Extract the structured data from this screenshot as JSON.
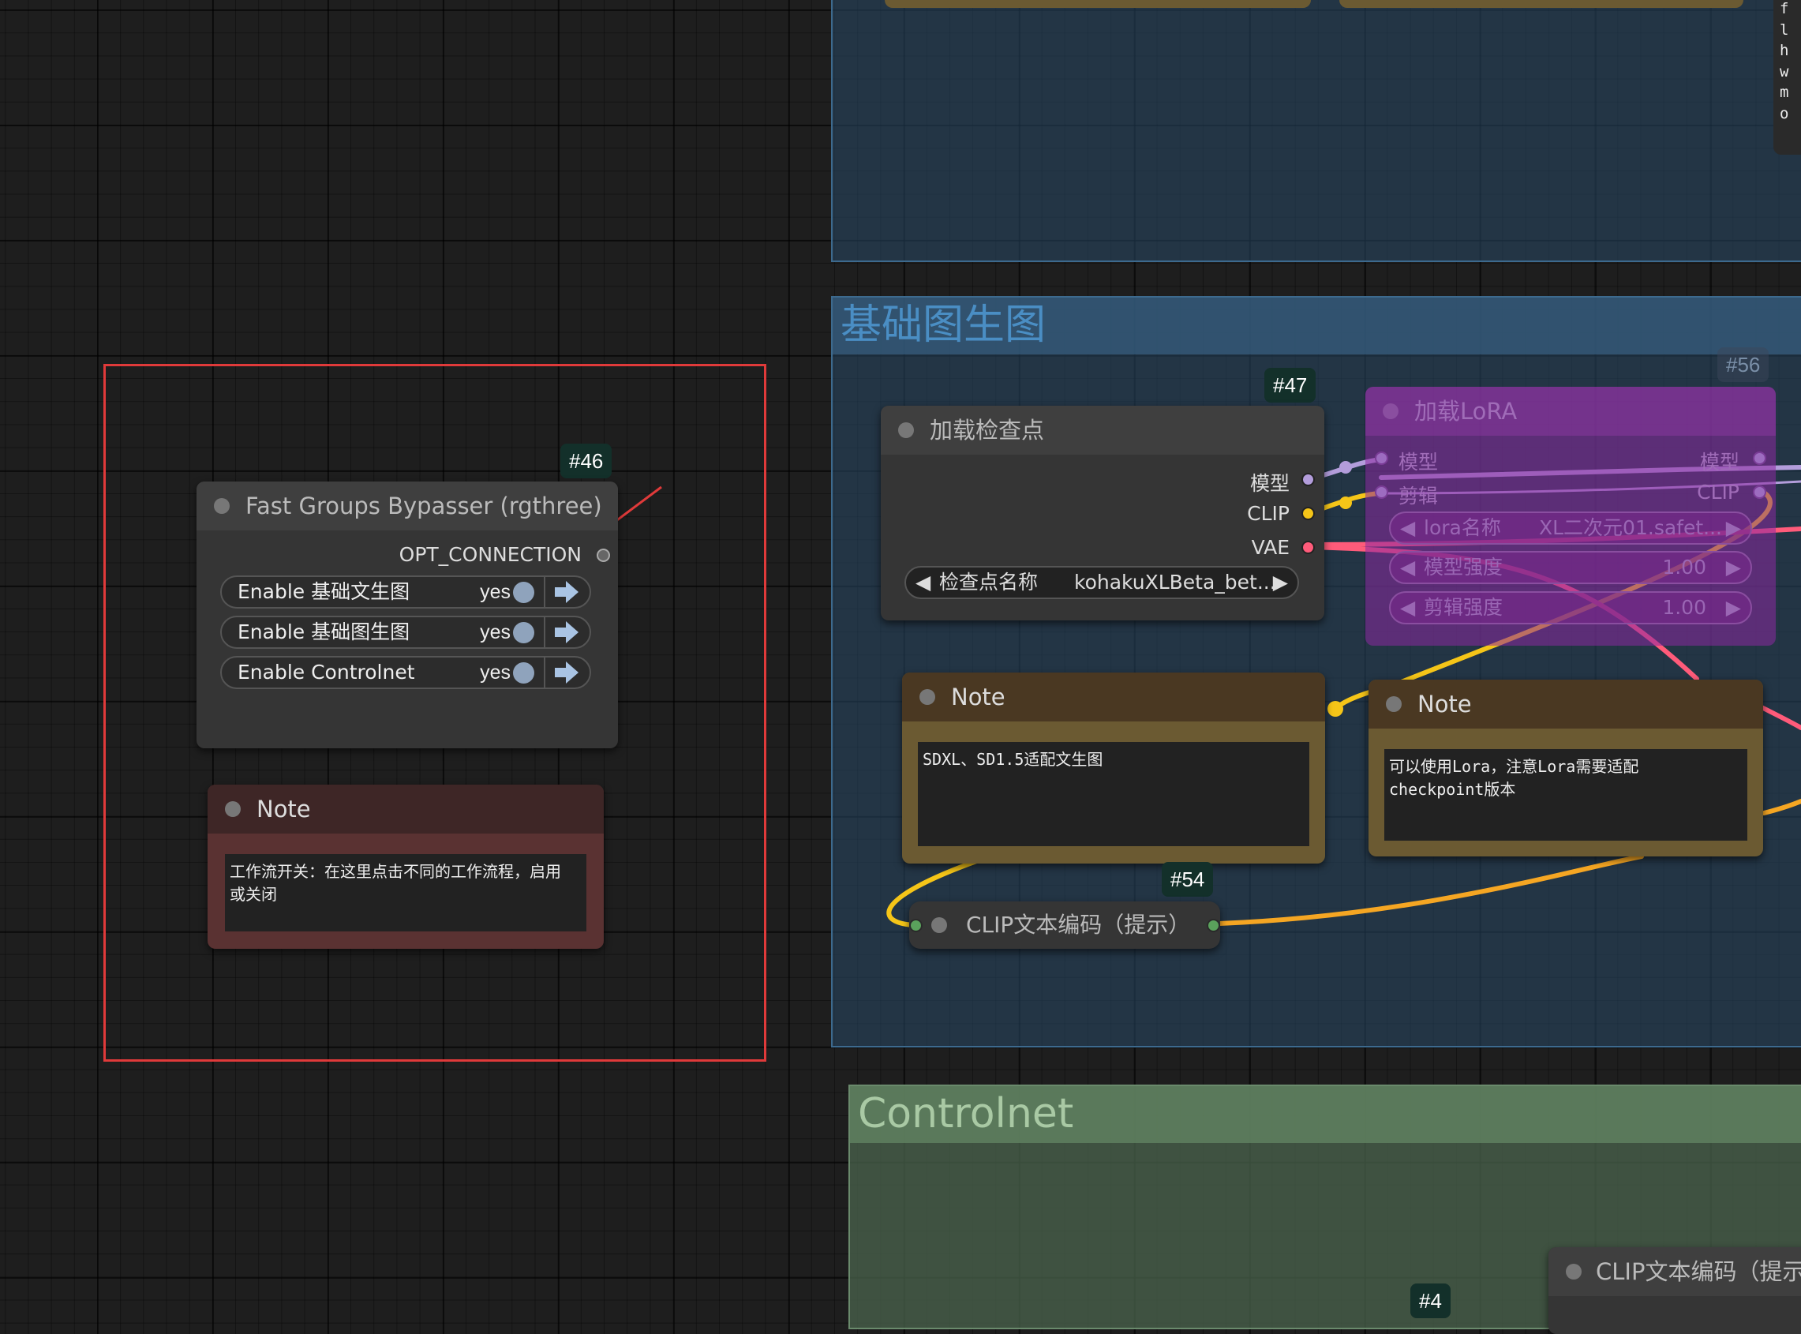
{
  "groups": {
    "top": {
      "title": ""
    },
    "img2img": {
      "title": "基础图生图"
    },
    "controlnet": {
      "title": "Controlnet"
    }
  },
  "top_note_fragment": [
    "f",
    "l",
    "h",
    "w",
    "m",
    "o"
  ],
  "bypasser": {
    "id": "#46",
    "title": "Fast Groups Bypasser (rgthree)",
    "output": "OPT_CONNECTION",
    "toggles": [
      {
        "label": "Enable 基础文生图",
        "value": "yes"
      },
      {
        "label": "Enable 基础图生图",
        "value": "yes"
      },
      {
        "label": "Enable Controlnet",
        "value": "yes"
      }
    ]
  },
  "note_left": {
    "title": "Note",
    "text": "工作流开关：在这里点击不同的工作流程，启用\n或关闭"
  },
  "checkpoint": {
    "id": "#47",
    "title": "加载检查点",
    "outputs": [
      "模型",
      "CLIP",
      "VAE"
    ],
    "widget_label": "检查点名称",
    "widget_value": "kohakuXLBeta_bet..."
  },
  "lora": {
    "id": "#56",
    "title": "加载LoRA",
    "inputs": [
      "模型",
      "剪辑"
    ],
    "outputs": [
      "模型",
      "CLIP"
    ],
    "widgets": [
      {
        "label": "lora名称",
        "value": "XL二次元01.safet..."
      },
      {
        "label": "模型强度",
        "value": "1.00"
      },
      {
        "label": "剪辑强度",
        "value": "1.00"
      }
    ]
  },
  "note_mid": {
    "title": "Note",
    "text": "SDXL、SD1.5适配文生图"
  },
  "note_right": {
    "title": "Note",
    "text": "可以使用Lora，注意Lora需要适配\ncheckpoint版本"
  },
  "clip_node": {
    "id": "#54",
    "title": "CLIP文本编码（提示）"
  },
  "clip_node2": {
    "id": "#4",
    "title": "CLIP文本编码（提示"
  },
  "colors": {
    "selection": "#e03a3a",
    "wire_model": "#b39ddb",
    "wire_clip": "#f5c518",
    "wire_vae": "#ff5b7a",
    "wire_orange": "#f5a623"
  }
}
